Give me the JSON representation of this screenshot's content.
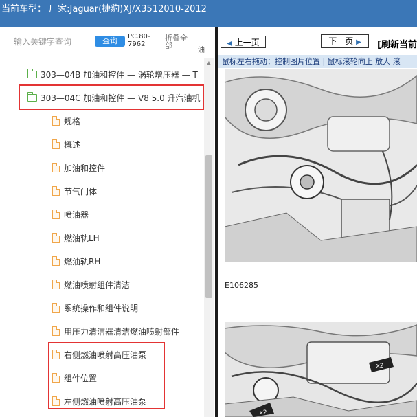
{
  "header": {
    "current_vehicle": "当前车型：  厂家:Jaguar(捷豹)XJ/X3512010-2012"
  },
  "search": {
    "placeholder": "输入关键字查询",
    "query_button": "查询",
    "pc_label": "PC.80-7962",
    "fold_all": "折叠全部",
    "oil_char": "油"
  },
  "tree": {
    "folders": [
      {
        "label": "303—04B 加油和控件 — 涡轮增压器 — T"
      },
      {
        "label": "303—04C 加油和控件 — V8 5.0 升汽油机"
      }
    ],
    "docs": [
      {
        "label": "规格"
      },
      {
        "label": "概述"
      },
      {
        "label": "加油和控件"
      },
      {
        "label": "节气门体"
      },
      {
        "label": "喷油器"
      },
      {
        "label": "燃油轨LH"
      },
      {
        "label": "燃油轨RH"
      },
      {
        "label": "燃油喷射组件清洁"
      },
      {
        "label": "系统操作和组件说明"
      },
      {
        "label": "用压力清洁器清洁燃油喷射部件"
      },
      {
        "label": "右侧燃油喷射高压油泵"
      },
      {
        "label": "组件位置"
      },
      {
        "label": "左侧燃油喷射高压油泵"
      }
    ]
  },
  "viewer": {
    "prev_page": "上一页",
    "next_page": "下一页",
    "refresh": "[刷新当前",
    "hint": "鼠标左右拖动：控制图片位置 | 鼠标滚轮向上 放大  滚",
    "figure_label": "E106285",
    "callout_1": "x2",
    "callout_2": "x2"
  },
  "colors": {
    "header_bg": "#3b77b7",
    "highlight_border": "#e33434",
    "query_button_bg": "#2f8de4",
    "viewer_bg": "#2e7fc1"
  }
}
